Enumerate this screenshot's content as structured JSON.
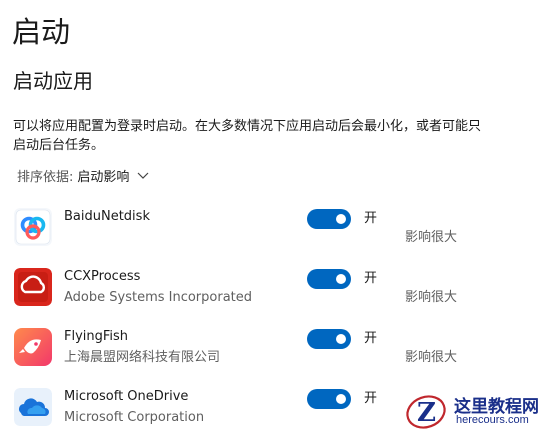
{
  "page": {
    "title": "启动",
    "section_title": "启动应用",
    "description": "可以将应用配置为登录时启动。在大多数情况下应用启动后会最小化，或者可能只启动后台任务。"
  },
  "sort": {
    "label": "排序依据:",
    "value": "启动影响"
  },
  "apps": [
    {
      "name": "BaiduNetdisk",
      "publisher": "",
      "toggle_state": "开",
      "impact": "影响很大",
      "icon": "baidunetdisk-icon"
    },
    {
      "name": "CCXProcess",
      "publisher": "Adobe Systems Incorporated",
      "toggle_state": "开",
      "impact": "影响很大",
      "icon": "adobe-creative-cloud-icon"
    },
    {
      "name": "FlyingFish",
      "publisher": "上海晨盟网络科技有限公司",
      "toggle_state": "开",
      "impact": "影响很大",
      "icon": "flyingfish-icon"
    },
    {
      "name": "Microsoft OneDrive",
      "publisher": "Microsoft Corporation",
      "toggle_state": "开",
      "impact": "",
      "icon": "onedrive-icon"
    }
  ],
  "watermark": {
    "text": "这里教程网",
    "url": "herecours.com"
  },
  "colors": {
    "accent": "#0067c0",
    "watermark": "#1a2f8a"
  }
}
